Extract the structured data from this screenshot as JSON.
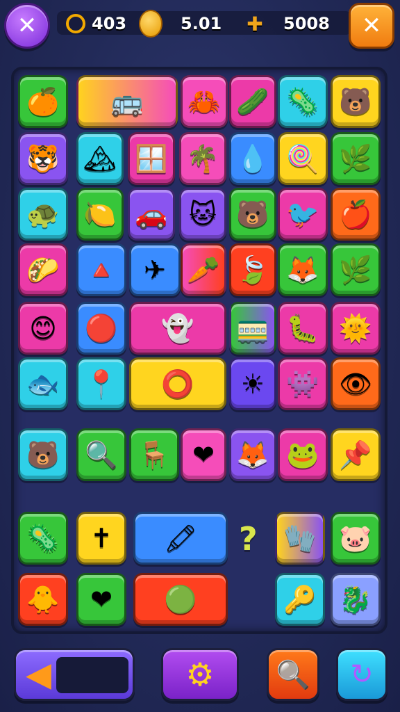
{
  "hud": {
    "coins": "403",
    "gold": "5.01",
    "score": "5008"
  },
  "icons": {
    "close_left": "close-icon",
    "close_right": "close-icon",
    "coins": "coin-ring-icon",
    "gold": "gold-coin-icon",
    "score": "bone-icon",
    "back": "back-arrow-icon",
    "settings": "gear-icon",
    "hint": "magnifier-icon",
    "shuffle": "refresh-icon"
  },
  "board": {
    "hint_symbol": "?",
    "tiles": [
      {
        "name": "tile-orange-fruit",
        "icon": "🍊",
        "color": "#37c63a"
      },
      {
        "name": "tile-bus",
        "icon": "🚌",
        "color": "linear-gradient(90deg,#ffd21f,#f54db9)"
      },
      {
        "name": "tile-crab",
        "icon": "🦀",
        "color": "#f54db9"
      },
      {
        "name": "tile-pickle",
        "icon": "🥒",
        "color": "#ec3aa8"
      },
      {
        "name": "tile-green-blob",
        "icon": "🦠",
        "color": "#2fd0e8"
      },
      {
        "name": "tile-pink-bear",
        "icon": "🐻",
        "color": "#ffd51f"
      },
      {
        "name": "tile-tiger",
        "icon": "🐯",
        "color": "#8a54f0"
      },
      {
        "name": "tile-mountain",
        "icon": "🏔",
        "color": "#2fd0e8"
      },
      {
        "name": "tile-window",
        "icon": "🪟",
        "color": "#ec3aa8"
      },
      {
        "name": "tile-palm",
        "icon": "🌴",
        "color": "#f54db9"
      },
      {
        "name": "tile-pink-drop",
        "icon": "💧",
        "color": "#3a8cff"
      },
      {
        "name": "tile-lollipop",
        "icon": "🍭",
        "color": "#ffd51f"
      },
      {
        "name": "tile-leaf",
        "icon": "🌿",
        "color": "#37c63a"
      },
      {
        "name": "tile-turtle",
        "icon": "🐢",
        "color": "#2fd0e8"
      },
      {
        "name": "tile-lemon",
        "icon": "🍋",
        "color": "#37c63a"
      },
      {
        "name": "tile-car",
        "icon": "🚗",
        "color": "#8a54f0"
      },
      {
        "name": "tile-cat",
        "icon": "🐱",
        "color": "#8a54f0"
      },
      {
        "name": "tile-bear-face",
        "icon": "🐻",
        "color": "#37c63a"
      },
      {
        "name": "tile-blue-bird",
        "icon": "🐦",
        "color": "#ec3aa8"
      },
      {
        "name": "tile-apple",
        "icon": "🍎",
        "color": "#ff6a1a"
      },
      {
        "name": "tile-taco",
        "icon": "🌮",
        "color": "#ec3aa8"
      },
      {
        "name": "tile-cone",
        "icon": "🔺",
        "color": "#3a8cff"
      },
      {
        "name": "tile-airplane",
        "icon": "✈",
        "color": "#3a8cff"
      },
      {
        "name": "tile-carrot",
        "icon": "🥕",
        "color": "linear-gradient(90deg,#f54db9,#ff4020)"
      },
      {
        "name": "tile-big-leaf",
        "icon": "🍃",
        "color": "#ff4020"
      },
      {
        "name": "tile-orange-critter",
        "icon": "🦊",
        "color": "#37c63a"
      },
      {
        "name": "tile-fern",
        "icon": "🌿",
        "color": "#37c63a"
      },
      {
        "name": "tile-smiley",
        "icon": "😊",
        "color": "#ec3aa8"
      },
      {
        "name": "tile-red-ball",
        "icon": "🔴",
        "color": "#3a8cff"
      },
      {
        "name": "tile-blue-ghost",
        "icon": "👻",
        "color": "#ec3aa8"
      },
      {
        "name": "tile-train",
        "icon": "🚃",
        "color": "linear-gradient(90deg,#37c63a,#8a54f0)"
      },
      {
        "name": "tile-green-bug",
        "icon": "🐛",
        "color": "#ec3aa8"
      },
      {
        "name": "tile-sun-face",
        "icon": "🌞",
        "color": "#ec3aa8"
      },
      {
        "name": "tile-fish",
        "icon": "🐟",
        "color": "#2fd0e8"
      },
      {
        "name": "tile-pin",
        "icon": "📍",
        "color": "#2fd0e8"
      },
      {
        "name": "tile-ring",
        "icon": "⭕",
        "color": "#ffd51f"
      },
      {
        "name": "tile-sun",
        "icon": "☀",
        "color": "#6b48f0"
      },
      {
        "name": "tile-orange-monster",
        "icon": "👾",
        "color": "#ec3aa8"
      },
      {
        "name": "tile-eye",
        "icon": "👁",
        "color": "#ff6a1a"
      },
      {
        "name": "tile-red-bear",
        "icon": "🐻",
        "color": "#2fd0e8"
      },
      {
        "name": "tile-magnifier",
        "icon": "🔍",
        "color": "#37c63a"
      },
      {
        "name": "tile-table",
        "icon": "🪑",
        "color": "#37c63a"
      },
      {
        "name": "tile-heart-pink",
        "icon": "❤",
        "color": "#f54db9"
      },
      {
        "name": "tile-fox",
        "icon": "🦊",
        "color": "#8a54f0"
      },
      {
        "name": "tile-green-face",
        "icon": "🐸",
        "color": "#ec3aa8"
      },
      {
        "name": "tile-pin-top",
        "icon": "📌",
        "color": "#ffd51f"
      },
      {
        "name": "tile-virus",
        "icon": "🦠",
        "color": "#37c63a"
      },
      {
        "name": "tile-cross",
        "icon": "✝",
        "color": "#ffd51f"
      },
      {
        "name": "tile-crayon",
        "icon": "🖍",
        "color": "#3a8cff"
      },
      {
        "name": "tile-glove",
        "icon": "🧤",
        "color": "linear-gradient(90deg,#ffd21f,#8a54f0)"
      },
      {
        "name": "tile-pig",
        "icon": "🐷",
        "color": "#37c63a"
      },
      {
        "name": "tile-yellow-critter",
        "icon": "🐥",
        "color": "#ff4020"
      },
      {
        "name": "tile-heart-red",
        "icon": "❤",
        "color": "#37c63a"
      },
      {
        "name": "tile-green-monster",
        "icon": "🟢",
        "color": "#ff4020"
      },
      {
        "name": "tile-key-fish",
        "icon": "🔑",
        "color": "#2fd0e8"
      },
      {
        "name": "tile-seahorse",
        "icon": "🐉",
        "color": "#8aa0ff"
      },
      {
        "name": "tile-sunflower",
        "icon": "🌞",
        "color": "#8a54f0"
      }
    ]
  }
}
